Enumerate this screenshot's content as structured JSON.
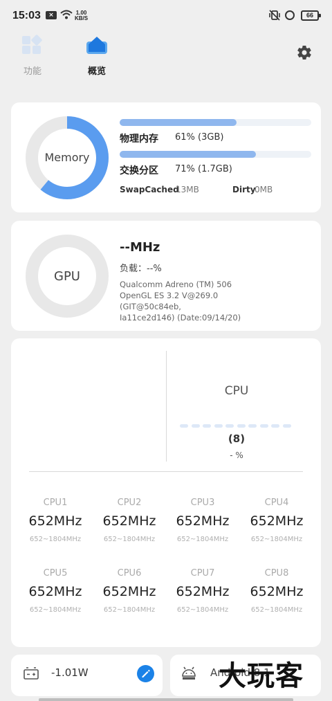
{
  "status_bar": {
    "time": "15:03",
    "speed_value": "1.00",
    "speed_unit": "KB/S",
    "battery": "66"
  },
  "tabs": [
    {
      "label": "功能",
      "icon": "grid-icon",
      "active": false
    },
    {
      "label": "概览",
      "icon": "home-icon",
      "active": true
    }
  ],
  "memory": {
    "ring_label": "Memory",
    "used_fraction": 0.61,
    "physical": {
      "label": "物理内存",
      "value": "61% (3GB)",
      "percent": 61
    },
    "swap": {
      "label": "交换分区",
      "value": "71% (1.7GB)",
      "percent": 71
    },
    "swap_cached": {
      "label": "SwapCached",
      "value": "13MB"
    },
    "dirty": {
      "label": "Dirty",
      "value": "0MB"
    }
  },
  "gpu": {
    "ring_label": "GPU",
    "freq": "--MHz",
    "load": "负载：--%",
    "info_line1": "Qualcomm Adreno (TM) 506",
    "info_line2": "OpenGL ES 3.2 V@269.0 (GIT@50c84eb,",
    "info_line3": "Ia11ce2d146) (Date:09/14/20)"
  },
  "cpu": {
    "title": "CPU",
    "cores_count": "(8)",
    "usage": "- %",
    "cores": [
      {
        "name": "CPU1",
        "freq": "652MHz",
        "range": "652~1804MHz"
      },
      {
        "name": "CPU2",
        "freq": "652MHz",
        "range": "652~1804MHz"
      },
      {
        "name": "CPU3",
        "freq": "652MHz",
        "range": "652~1804MHz"
      },
      {
        "name": "CPU4",
        "freq": "652MHz",
        "range": "652~1804MHz"
      },
      {
        "name": "CPU5",
        "freq": "652MHz",
        "range": "652~1804MHz"
      },
      {
        "name": "CPU6",
        "freq": "652MHz",
        "range": "652~1804MHz"
      },
      {
        "name": "CPU7",
        "freq": "652MHz",
        "range": "652~1804MHz"
      },
      {
        "name": "CPU8",
        "freq": "652MHz",
        "range": "652~1804MHz"
      }
    ]
  },
  "power": {
    "value": "-1.01W",
    "icon": "battery-icon"
  },
  "android": {
    "value": "Android 8.1",
    "icon": "android-icon"
  },
  "watermark": "大玩客",
  "colors": {
    "accent_blue": "#5a9cef",
    "ring_track": "#e8e8e8",
    "bar_fill": "#8fb7ee",
    "edit_button": "#1b82e7"
  }
}
